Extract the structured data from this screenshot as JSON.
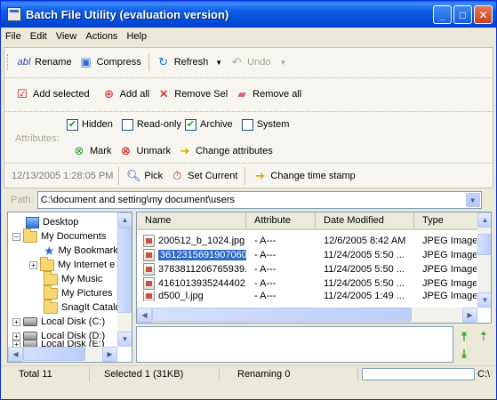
{
  "window": {
    "title": "Batch File Utility (evaluation version)"
  },
  "menu": [
    "File",
    "Edit",
    "View",
    "Actions",
    "Help"
  ],
  "toolbar1": {
    "rename": "Rename",
    "compress": "Compress",
    "refresh": "Refresh",
    "undo": "Undo"
  },
  "toolbar2": {
    "add_selected": "Add selected",
    "add_all": "Add all",
    "remove_sel": "Remove Sel",
    "remove_all": "Remove all"
  },
  "attributes": {
    "label": "Attributes:",
    "hidden": "Hidden",
    "hidden_checked": true,
    "readonly": "Read-only",
    "readonly_checked": false,
    "archive": "Archive",
    "archive_checked": true,
    "system": "System",
    "system_checked": false,
    "mark": "Mark",
    "unmark": "Unmark",
    "change": "Change attributes"
  },
  "timestamp": {
    "value": "12/13/2005 1:28:05 PM",
    "pick": "Pick",
    "set_current": "Set Current",
    "change": "Change time stamp"
  },
  "path": {
    "label": "Path:",
    "value": "C:\\document and setting\\my document\\users"
  },
  "tree": {
    "desktop": "Desktop",
    "my_documents": "My Documents",
    "bookmarks": "My Bookmark",
    "internet": "My Internet e",
    "music": "My Music",
    "pictures": "My Pictures",
    "snagit": "SnagIt Catalo",
    "disk_c": "Local Disk (C:)",
    "disk_d": "Local Disk (D:)",
    "disk_e": "Local Disk (E:)"
  },
  "list": {
    "headers": {
      "name": "Name",
      "attribute": "Attribute",
      "date": "Date Modified",
      "type": "Type"
    },
    "rows": [
      {
        "name": "200512_b_1024.jpg",
        "attr": "- A---",
        "date": "12/6/2005 8:42 AM",
        "type": "JPEG Image",
        "selected": false
      },
      {
        "name": "3612315691907060...",
        "attr": "- A---",
        "date": "11/24/2005 5:50 ...",
        "type": "JPEG Image",
        "selected": true
      },
      {
        "name": "3783811206765939...",
        "attr": "- A---",
        "date": "11/24/2005 5:50 ...",
        "type": "JPEG Image",
        "selected": false
      },
      {
        "name": "4161013935244402...",
        "attr": "- A---",
        "date": "11/24/2005 5:50 ...",
        "type": "JPEG Image",
        "selected": false
      },
      {
        "name": "d500_l.jpg",
        "attr": "- A---",
        "date": "11/24/2005 1:49 ...",
        "type": "JPEG Image",
        "selected": false
      }
    ]
  },
  "status": {
    "total": "Total  11",
    "selected": "Selected  1 (31KB)",
    "renaming": "Renaming   0",
    "drive": "C:\\"
  },
  "colors": {
    "title_bar": "#0a5be5",
    "selection": "#316ac5",
    "check": "#21a121"
  }
}
